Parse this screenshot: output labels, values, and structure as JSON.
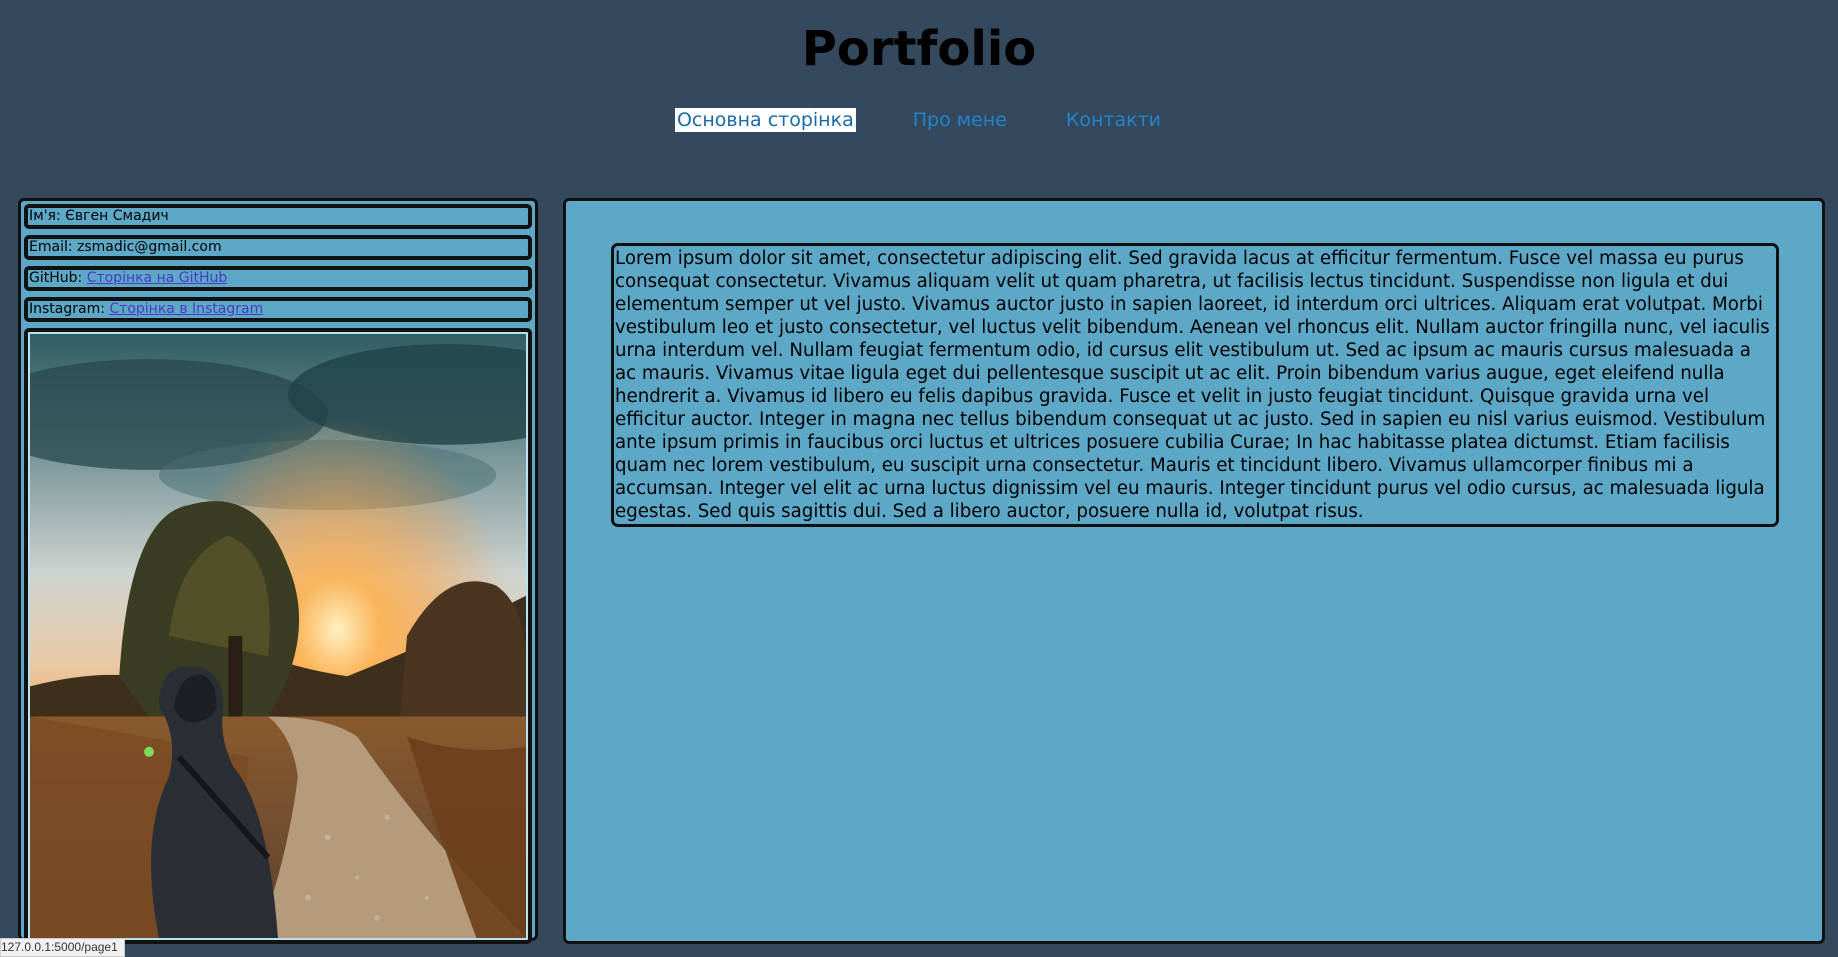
{
  "header": {
    "title": "Portfolio"
  },
  "nav": {
    "items": [
      {
        "label": "Основна сторінка",
        "active": true
      },
      {
        "label": "Про мене",
        "active": false
      },
      {
        "label": "Контакти",
        "active": false
      }
    ]
  },
  "sidebar": {
    "name_label": "Ім'я:",
    "name_value": "Євген Смадич",
    "email_label": "Email:",
    "email_value": "zsmadic@gmail.com",
    "github_label": "GitHub:",
    "github_link": "Сторінка на GitHub",
    "instagram_label": "Instagram:",
    "instagram_link": "Сторінка в Instagram"
  },
  "main": {
    "text": "Lorem ipsum dolor sit amet, consectetur adipiscing elit. Sed gravida lacus at efficitur fermentum. Fusce vel massa eu purus consequat consectetur. Vivamus aliquam velit ut quam pharetra, ut facilisis lectus tincidunt. Suspendisse non ligula et dui elementum semper ut vel justo. Vivamus auctor justo in sapien laoreet, id interdum orci ultrices. Aliquam erat volutpat. Morbi vestibulum leo et justo consectetur, vel luctus velit bibendum. Aenean vel rhoncus elit. Nullam auctor fringilla nunc, vel iaculis urna interdum vel. Nullam feugiat fermentum odio, id cursus elit vestibulum ut. Sed ac ipsum ac mauris cursus malesuada a ac mauris. Vivamus vitae ligula eget dui pellentesque suscipit ut ac elit. Proin bibendum varius augue, eget eleifend nulla hendrerit a. Vivamus id libero eu felis dapibus gravida. Fusce et velit in justo feugiat tincidunt. Quisque gravida urna vel efficitur auctor. Integer in magna nec tellus bibendum consequat ut ac justo. Sed in sapien eu nisl varius euismod. Vestibulum ante ipsum primis in faucibus orci luctus et ultrices posuere cubilia Curae; In hac habitasse platea dictumst. Etiam facilisis quam nec lorem vestibulum, eu suscipit urna consectetur. Mauris et tincidunt libero. Vivamus ullamcorper finibus mi a accumsan. Integer vel elit ac urna luctus dignissim vel eu mauris. Integer tincidunt purus vel odio cursus, ac malesuada ligula egestas. Sed quis sagittis dui. Sed a libero auctor, posuere nulla id, volutpat risus."
  },
  "status_bar": {
    "url": "127.0.0.1:5000/page1"
  },
  "colors": {
    "page_background": "#34495e",
    "panel_background": "#5da7c7",
    "nav_link": "#2384c8",
    "border": "#111111"
  }
}
